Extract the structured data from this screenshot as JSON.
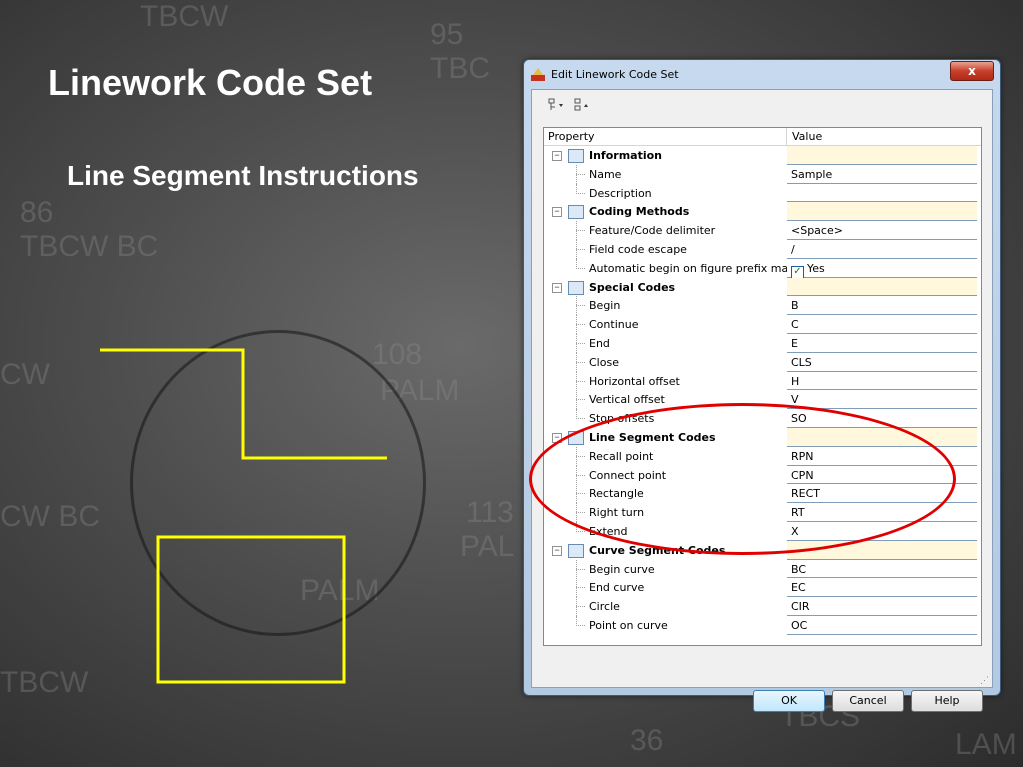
{
  "slide": {
    "title": "Linework Code Set",
    "subtitle": "Line Segment Instructions"
  },
  "background_labels": [
    "TBCW",
    "95",
    "TBC",
    "86",
    "TBCW BC",
    "CW",
    "108",
    "PALM",
    "CW BC",
    "113",
    "PAL",
    "PALM",
    "TBCW",
    "36",
    "LAM",
    "TBCS"
  ],
  "colors": {
    "shape_stroke": "#ffff00",
    "highlight": "#e00000",
    "category_value_bg": "#fff8dc"
  },
  "dialog": {
    "title": "Edit Linework Code Set",
    "close_label": "x",
    "toolbar": {
      "categorized_icon": "categorized-view-icon",
      "alphabetical_icon": "alphabetical-sort-icon"
    },
    "columns": {
      "property": "Property",
      "value": "Value"
    },
    "rows": [
      {
        "type": "category",
        "label": "Information",
        "value": ""
      },
      {
        "type": "property",
        "label": "Name",
        "value": "Sample"
      },
      {
        "type": "property",
        "label": "Description",
        "value": ""
      },
      {
        "type": "category",
        "label": "Coding Methods",
        "value": ""
      },
      {
        "type": "property",
        "label": "Feature/Code delimiter",
        "value": "<Space>"
      },
      {
        "type": "property",
        "label": "Field code escape",
        "value": "/"
      },
      {
        "type": "property",
        "label": "Automatic begin on figure prefix match",
        "value": "Yes",
        "checkbox": true
      },
      {
        "type": "category",
        "label": "Special Codes",
        "value": ""
      },
      {
        "type": "property",
        "label": "Begin",
        "value": "B"
      },
      {
        "type": "property",
        "label": "Continue",
        "value": "C"
      },
      {
        "type": "property",
        "label": "End",
        "value": "E"
      },
      {
        "type": "property",
        "label": "Close",
        "value": "CLS"
      },
      {
        "type": "property",
        "label": "Horizontal offset",
        "value": "H"
      },
      {
        "type": "property",
        "label": "Vertical offset",
        "value": "V"
      },
      {
        "type": "property",
        "label": "Stop offsets",
        "value": "SO"
      },
      {
        "type": "category",
        "label": "Line Segment Codes",
        "value": ""
      },
      {
        "type": "property",
        "label": "Recall point",
        "value": "RPN"
      },
      {
        "type": "property",
        "label": "Connect point",
        "value": "CPN"
      },
      {
        "type": "property",
        "label": "Rectangle",
        "value": "RECT"
      },
      {
        "type": "property",
        "label": "Right turn",
        "value": "RT"
      },
      {
        "type": "property",
        "label": "Extend",
        "value": "X"
      },
      {
        "type": "category",
        "label": "Curve Segment Codes",
        "value": ""
      },
      {
        "type": "property",
        "label": "Begin curve",
        "value": "BC"
      },
      {
        "type": "property",
        "label": "End curve",
        "value": "EC"
      },
      {
        "type": "property",
        "label": "Circle",
        "value": "CIR"
      },
      {
        "type": "property",
        "label": "Point on curve",
        "value": "OC"
      }
    ],
    "buttons": {
      "ok": "OK",
      "cancel": "Cancel",
      "help": "Help"
    }
  }
}
